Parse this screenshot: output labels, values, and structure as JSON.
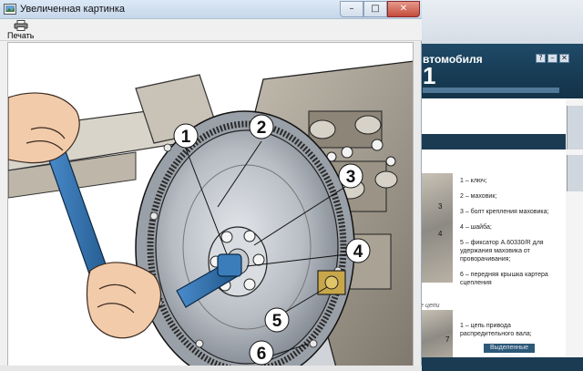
{
  "window": {
    "title": "Увеличенная картинка",
    "minimize_glyph": "–",
    "maximize_glyph": "□",
    "close_glyph": "✕"
  },
  "toolbar": {
    "print_label": "Печать",
    "print_icon": "printer-icon"
  },
  "figure": {
    "callouts": [
      "1",
      "2",
      "3",
      "4",
      "5",
      "6"
    ],
    "colors": {
      "outline": "#1a1a1a",
      "metal": "#bfc3c8",
      "metal_dark": "#7f8690",
      "wrench": "#2f6fa6",
      "skin": "#f0c9a8",
      "engine": "#a59b8a"
    }
  },
  "background_app": {
    "banner_title": "втомобиля",
    "banner_big": "1",
    "window_buttons": [
      "?",
      "–",
      "✕"
    ],
    "legend": [
      "1 – ключ;",
      "2 – маховик;",
      "3 – болт крепления маховика;",
      "4 – шайба;",
      "5 – фиксатор А.60330/R для удержания маховика от проворачивания;",
      "6 – передняя крышка картера сцепления"
    ],
    "section_caption": "е цепи",
    "bottom_item": "1 – цепь привода распредительного вала;",
    "thumb_labels": [
      "3",
      "4",
      "7"
    ],
    "footer_button": "Выделенные записи"
  }
}
